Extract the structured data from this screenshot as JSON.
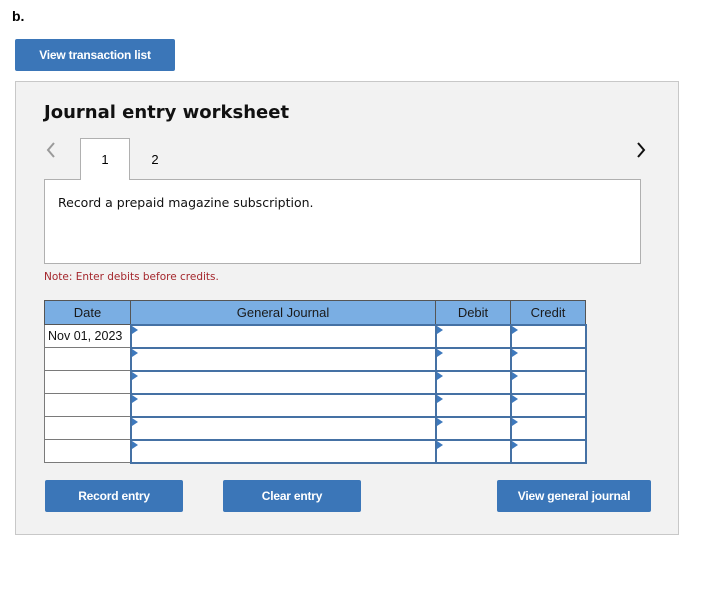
{
  "part_label": "b.",
  "view_transaction_list_label": "View transaction list",
  "worksheet": {
    "title": "Journal entry worksheet",
    "tabs": [
      {
        "label": "1",
        "active": true
      },
      {
        "label": "2",
        "active": false
      }
    ],
    "prev_icon": "chevron-left-icon",
    "next_icon": "chevron-right-icon",
    "prompt": "Record a prepaid magazine subscription.",
    "note": "Note: Enter debits before credits.",
    "table": {
      "headers": [
        "Date",
        "General Journal",
        "Debit",
        "Credit"
      ],
      "rows": [
        {
          "date": "Nov 01, 2023",
          "account": "",
          "debit": "",
          "credit": ""
        },
        {
          "date": "",
          "account": "",
          "debit": "",
          "credit": ""
        },
        {
          "date": "",
          "account": "",
          "debit": "",
          "credit": ""
        },
        {
          "date": "",
          "account": "",
          "debit": "",
          "credit": ""
        },
        {
          "date": "",
          "account": "",
          "debit": "",
          "credit": ""
        },
        {
          "date": "",
          "account": "",
          "debit": "",
          "credit": ""
        }
      ]
    },
    "buttons": {
      "record": "Record entry",
      "clear": "Clear entry",
      "view_general_journal": "View general journal"
    }
  },
  "colors": {
    "button_bg": "#3b76b8",
    "header_bg": "#7aaee3",
    "note_text": "#a4262c",
    "input_border": "#4571a4"
  }
}
